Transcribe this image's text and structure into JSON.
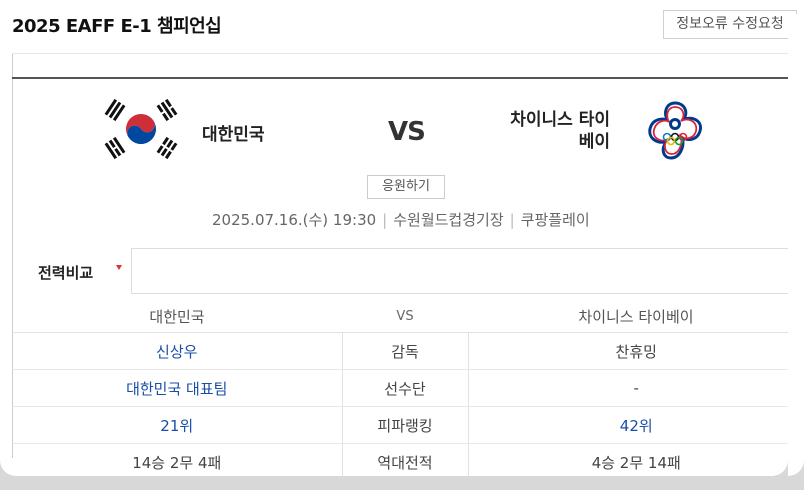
{
  "header": {
    "title": "2025 EAFF E-1 챔피언십",
    "report_button": "정보오류 수정요청"
  },
  "match": {
    "home_team": "대한민국",
    "away_team_line1": "차이니스 타이",
    "away_team_line2": "베이",
    "vs": "VS",
    "cheer_button": "응원하기",
    "datetime": "2025.07.16.(수) 19:30",
    "venue": "수원월드컵경기장",
    "broadcaster": "쿠팡플레이",
    "divider": "|"
  },
  "comparison": {
    "tab_label": "전력비교",
    "header": {
      "home": "대한민국",
      "vs": "VS",
      "away": "차이니스 타이베이"
    },
    "rows": [
      {
        "label": "감독",
        "home": "신상우",
        "away": "찬휴밍"
      },
      {
        "label": "선수단",
        "home": "대한민국 대표팀",
        "away": "-"
      },
      {
        "label": "피파랭킹",
        "home": "21위",
        "away": "42위"
      },
      {
        "label": "역대전적",
        "home": "14승 2무 4패",
        "away": "4승 2무 14패"
      }
    ]
  },
  "colors": {
    "link": "#1a4ea8",
    "kr_red": "#cd2e3a",
    "kr_blue": "#0047a0",
    "tpe_blue": "#003a8c",
    "tpe_red": "#d6243d",
    "caret": "#e03030"
  },
  "icons": {
    "home_flag": "south-korea-flag-icon",
    "away_flag": "chinese-taipei-flag-icon",
    "tab_caret": "caret-down-icon"
  }
}
